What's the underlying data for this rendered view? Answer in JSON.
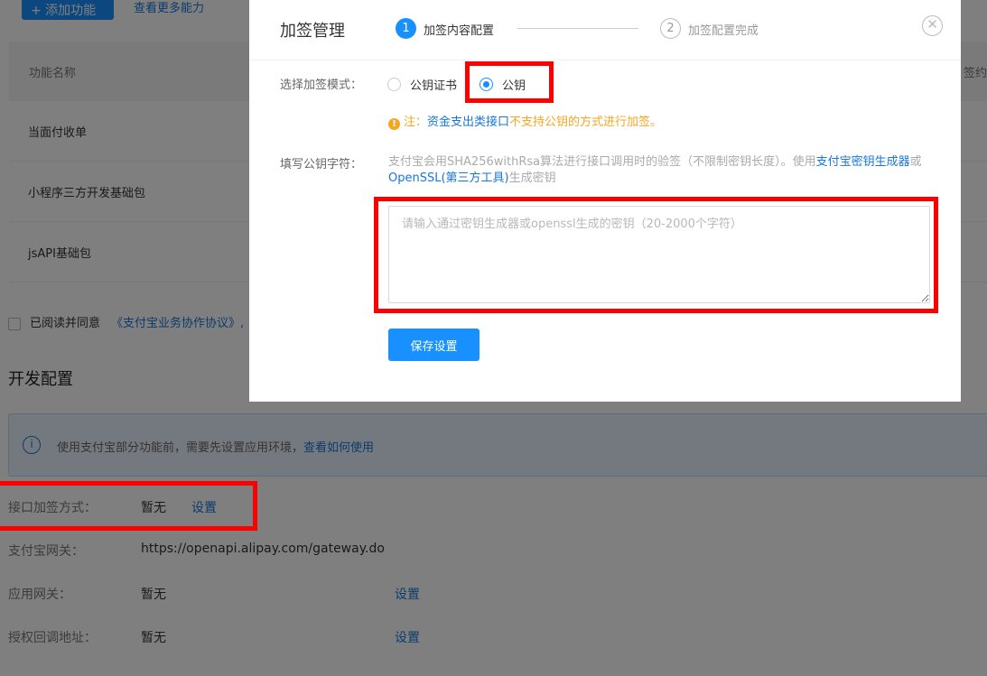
{
  "background": {
    "top_buttons": {
      "add_label": "+ 添加功能",
      "more_label": "查看更多能力"
    },
    "table": {
      "header_name": "功能名称",
      "header_right": "签约",
      "rows": [
        "当面付收单",
        "小程序三方开发基础包",
        "jsAPI基础包"
      ]
    },
    "agreement": {
      "text": "已阅读并同意",
      "link": "《支付宝业务协作协议》,"
    },
    "dev_config": {
      "title": "开发配置",
      "info_text": "使用支付宝部分功能前，需要先设置应用环境，",
      "info_link": "查看如何使用",
      "rows": [
        {
          "label": "接口加签方式：",
          "value": "暂无",
          "link": "设置"
        },
        {
          "label": "支付宝网关：",
          "value": "https://openapi.alipay.com/gateway.do",
          "link": ""
        },
        {
          "label": "应用网关：",
          "value": "暂无",
          "link": "设置"
        },
        {
          "label": "授权回调地址：",
          "value": "暂无",
          "link": "设置"
        }
      ]
    }
  },
  "modal": {
    "title": "加签管理",
    "steps": [
      {
        "num": "1",
        "label": "加签内容配置"
      },
      {
        "num": "2",
        "label": "加签配置完成"
      }
    ],
    "close_symbol": "✕",
    "mode_label": "选择加签模式：",
    "mode_options": [
      "公钥证书",
      "公钥"
    ],
    "notice": {
      "prefix": "注：",
      "link": "资金支出类接口",
      "suffix": "不支持公钥的方式进行加签。"
    },
    "key_label": "填写公钥字符：",
    "key_desc": {
      "text1": "支付宝会用SHA256withRsa算法进行接口调用时的验签（不限制密钥长度）。使用",
      "link1": "支付宝密钥生成器",
      "text2": "或",
      "link2": "OpenSSL(第三方工具)",
      "text3": "生成密钥"
    },
    "key_placeholder": "请输入通过密钥生成器或openssl生成的密钥（20-2000个字符）",
    "key_value": "",
    "save_label": "保存设置"
  },
  "colors": {
    "accent": "#1890ff",
    "highlight": "#ff0000",
    "warning": "#f5a623"
  }
}
